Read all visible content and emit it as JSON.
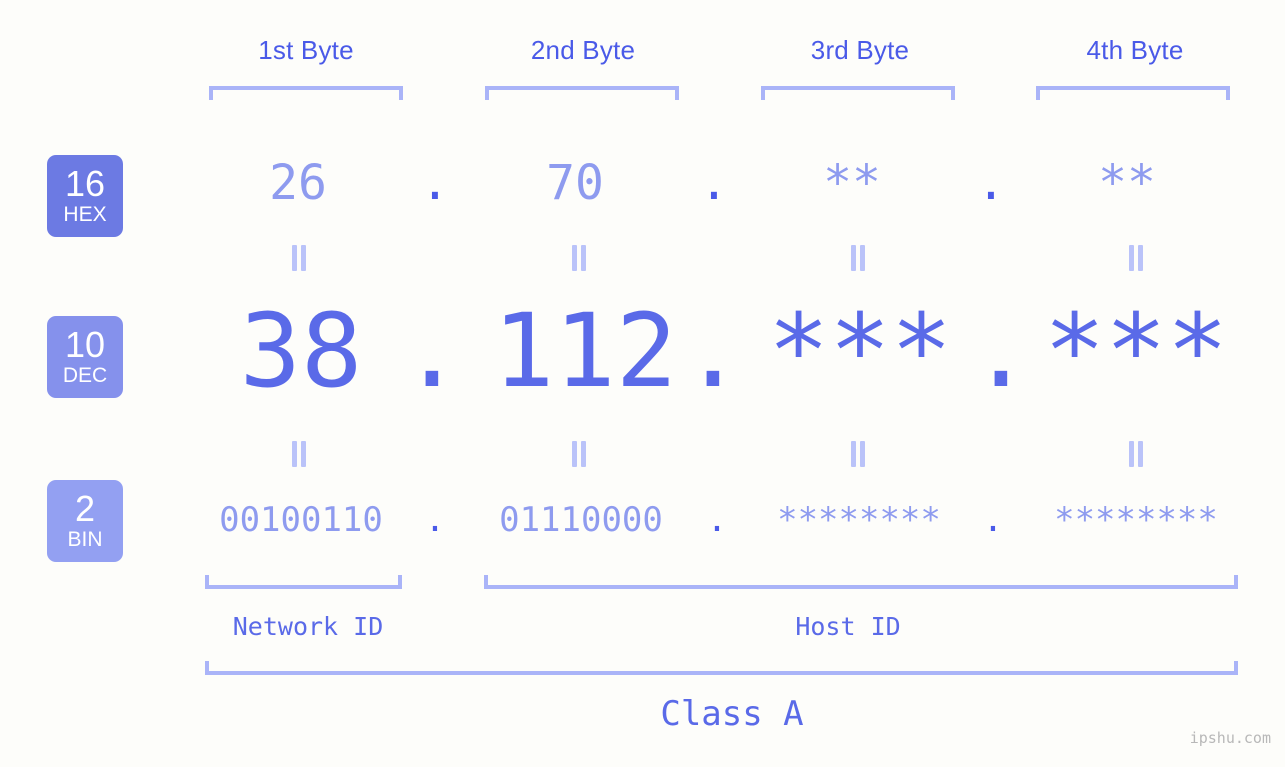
{
  "meta": {
    "background_color": "#fdfdfa",
    "accent_color": "#5a6ae8",
    "accent_light_color": "#8e9bef",
    "bracket_color": "#aab4f8"
  },
  "byte_headers": [
    {
      "label": "1st Byte"
    },
    {
      "label": "2nd Byte"
    },
    {
      "label": "3rd Byte"
    },
    {
      "label": "4th Byte"
    }
  ],
  "rows": {
    "hex": {
      "badge_number": "16",
      "badge_name": "HEX",
      "badge_color": "#6c7ae3",
      "values": [
        "26",
        "70",
        "**",
        "**"
      ],
      "separator": "."
    },
    "dec": {
      "badge_number": "10",
      "badge_name": "DEC",
      "badge_color": "#8591ec",
      "values": [
        "38",
        "112",
        "***",
        "***"
      ],
      "separator": "."
    },
    "bin": {
      "badge_number": "2",
      "badge_name": "BIN",
      "badge_color": "#93a0f2",
      "values": [
        "00100110",
        "01110000",
        "********",
        "********"
      ],
      "separator": "."
    }
  },
  "equals_symbol": "=",
  "id_groups": [
    {
      "label": "Network ID"
    },
    {
      "label": "Host ID"
    }
  ],
  "class_label": "Class A",
  "watermark": "ipshu.com"
}
